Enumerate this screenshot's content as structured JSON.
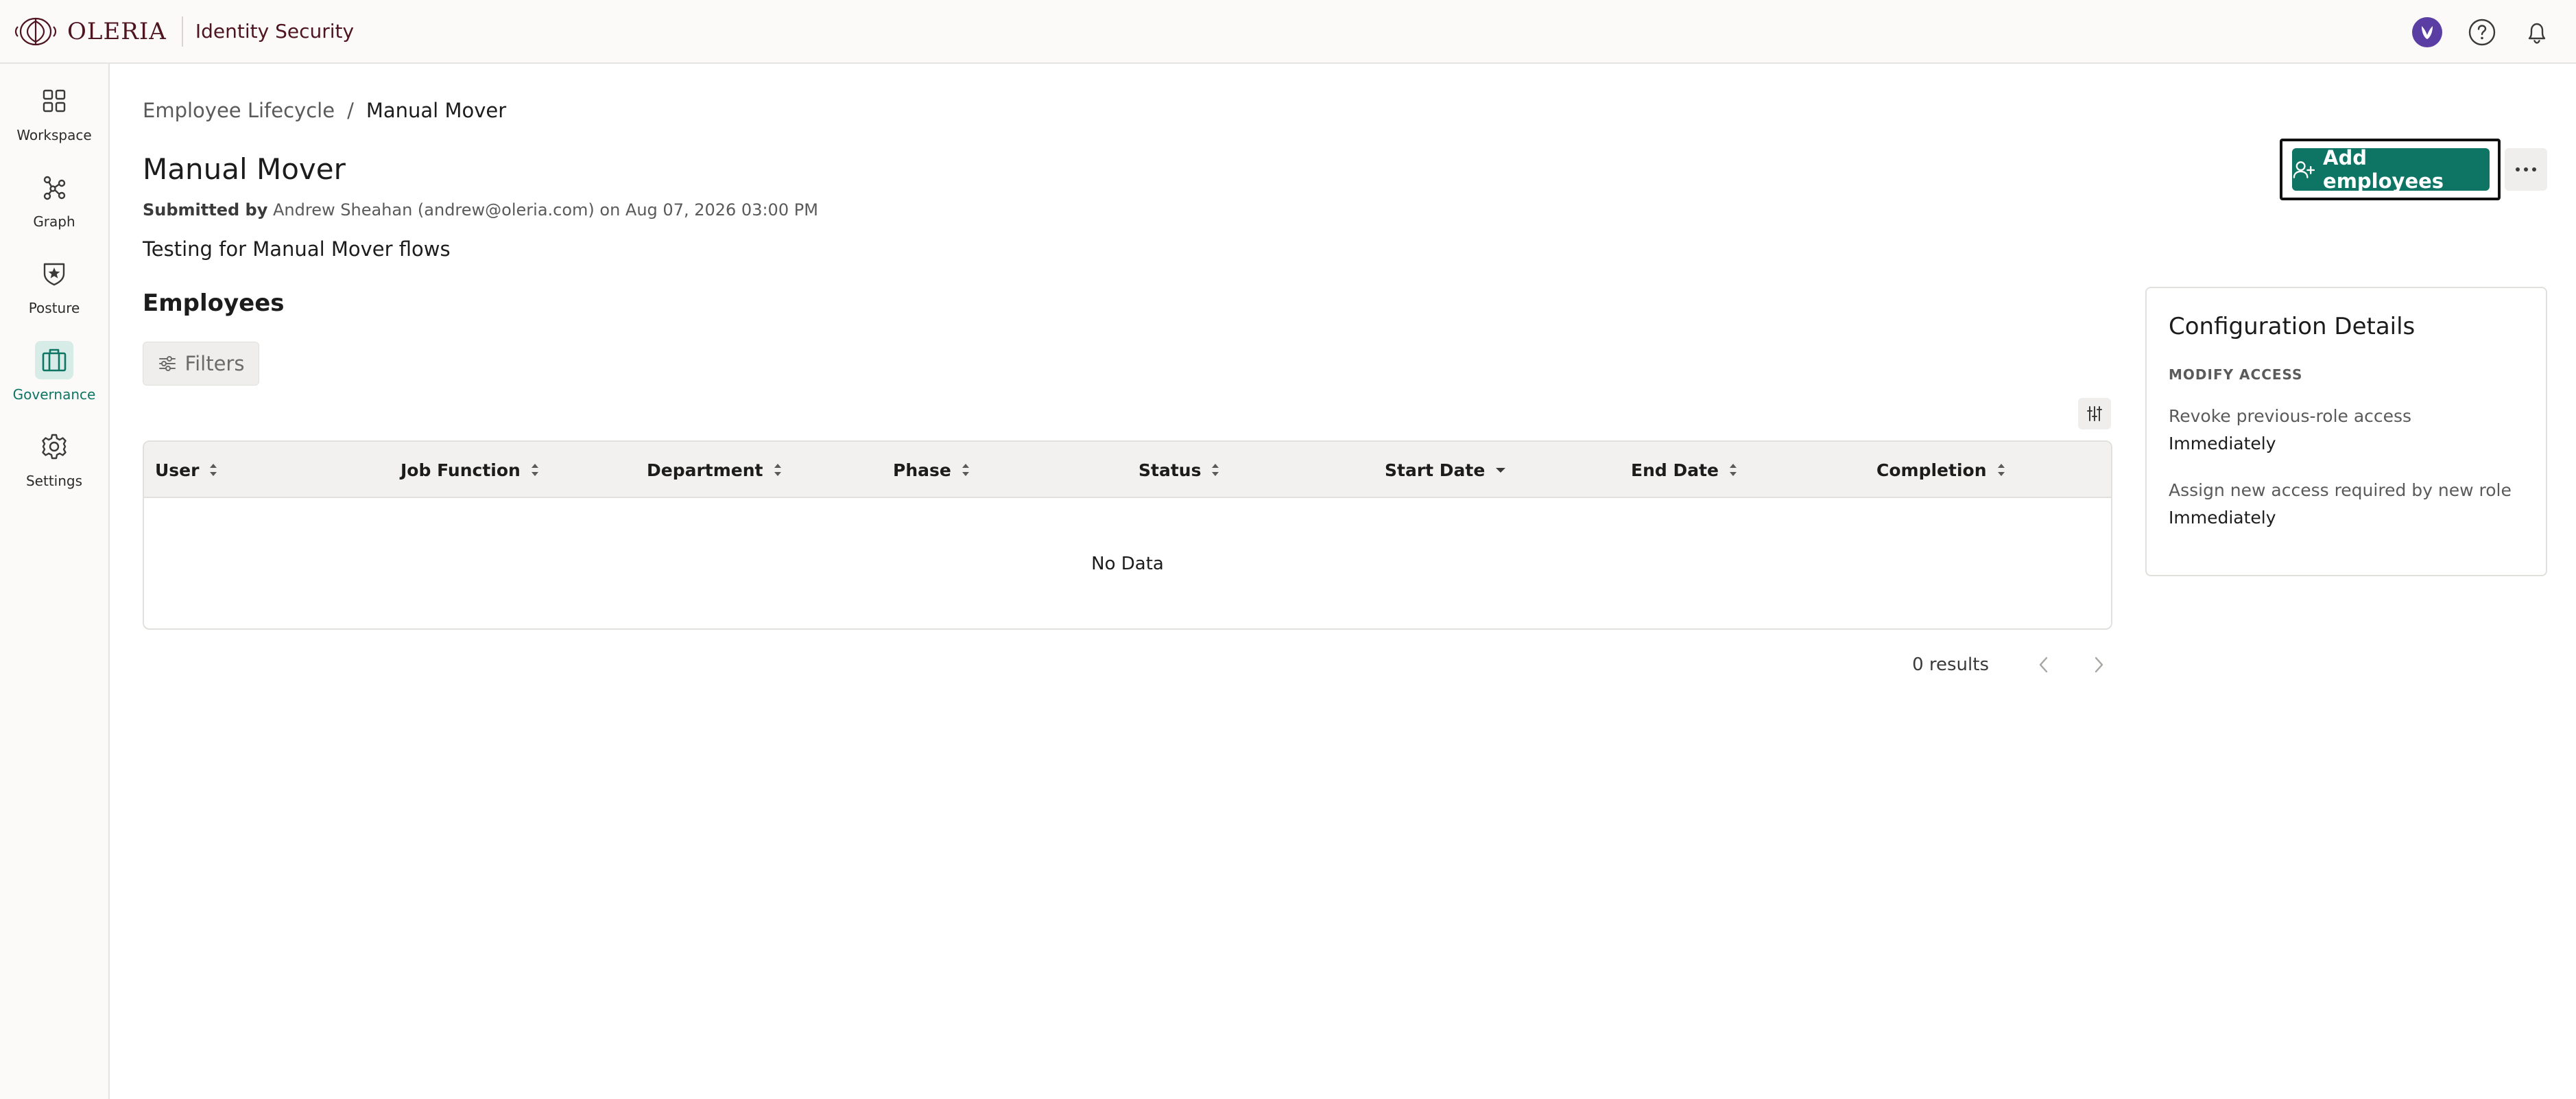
{
  "app": {
    "brand": "OLERIA",
    "product": "Identity Security"
  },
  "sidebar": {
    "items": [
      {
        "label": "Workspace",
        "icon": "grid-icon",
        "active": false
      },
      {
        "label": "Graph",
        "icon": "graph-icon",
        "active": false
      },
      {
        "label": "Posture",
        "icon": "shield-star-icon",
        "active": false
      },
      {
        "label": "Governance",
        "icon": "briefcase-icon",
        "active": true
      },
      {
        "label": "Settings",
        "icon": "gear-icon",
        "active": false
      }
    ]
  },
  "breadcrumb": {
    "parent": "Employee Lifecycle",
    "separator": "/",
    "current": "Manual Mover"
  },
  "header": {
    "title": "Manual Mover",
    "submitted_label": "Submitted by",
    "submitted_text": "Andrew Sheahan (andrew@oleria.com) on Aug 07, 2026 03:00 PM",
    "description": "Testing for Manual Mover flows"
  },
  "actions": {
    "add_label": "Add employees"
  },
  "employees": {
    "section_title": "Employees",
    "filters_label": "Filters",
    "columns": [
      "User",
      "Job Function",
      "Department",
      "Phase",
      "Status",
      "Start Date",
      "End Date",
      "Completion"
    ],
    "sorted_column": "Start Date",
    "empty_text": "No Data",
    "results_text": "0 results"
  },
  "config": {
    "title": "Configuration Details",
    "section": "MODIFY ACCESS",
    "items": [
      {
        "label": "Revoke previous-role access",
        "value": "Immediately"
      },
      {
        "label": "Assign new access required by new role",
        "value": "Immediately"
      }
    ]
  },
  "colors": {
    "brand": "#4e1420",
    "accent": "#0e7565",
    "accent_light": "#d8ece7",
    "avatar": "#5b3ea3"
  }
}
